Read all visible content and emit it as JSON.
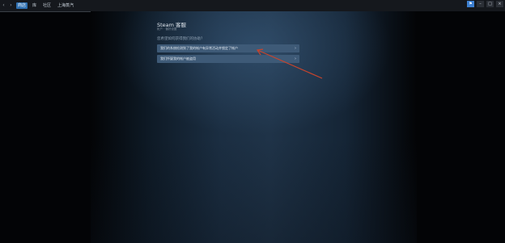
{
  "topbar": {
    "back_icon": "arrow-left-icon",
    "forward_icon": "arrow-right-icon",
    "tabs": [
      {
        "label": "商店",
        "active": true
      },
      {
        "label": "库",
        "active": false
      },
      {
        "label": "社区",
        "active": false
      },
      {
        "label": "上海蒸汽",
        "active": false
      }
    ],
    "window_controls": {
      "notify_icon": "bell-icon",
      "minimize_icon": "minimize-icon",
      "maximize_icon": "maximize-icon",
      "close_icon": "close-icon"
    }
  },
  "main": {
    "title": "Steam 客服",
    "subtitle": "帐户 · 偏好设置",
    "question": "您希望如何获得我们的协助？",
    "options": [
      {
        "label": "我们的系统检测到了我的帐户有异常活动并锁定了帐户",
        "chevron_icon": "chevron-right-icon"
      },
      {
        "label": "我们怀疑我的帐户被盗用",
        "chevron_icon": "chevron-right-icon"
      }
    ]
  },
  "annotation": {
    "color": "#c8442c",
    "shape": "arrow"
  },
  "colors": {
    "topbar_bg": "#15181d",
    "active_tab": "#2e6fb0",
    "option_bg": "#3e5a77",
    "panel_center": "#1f3348"
  }
}
